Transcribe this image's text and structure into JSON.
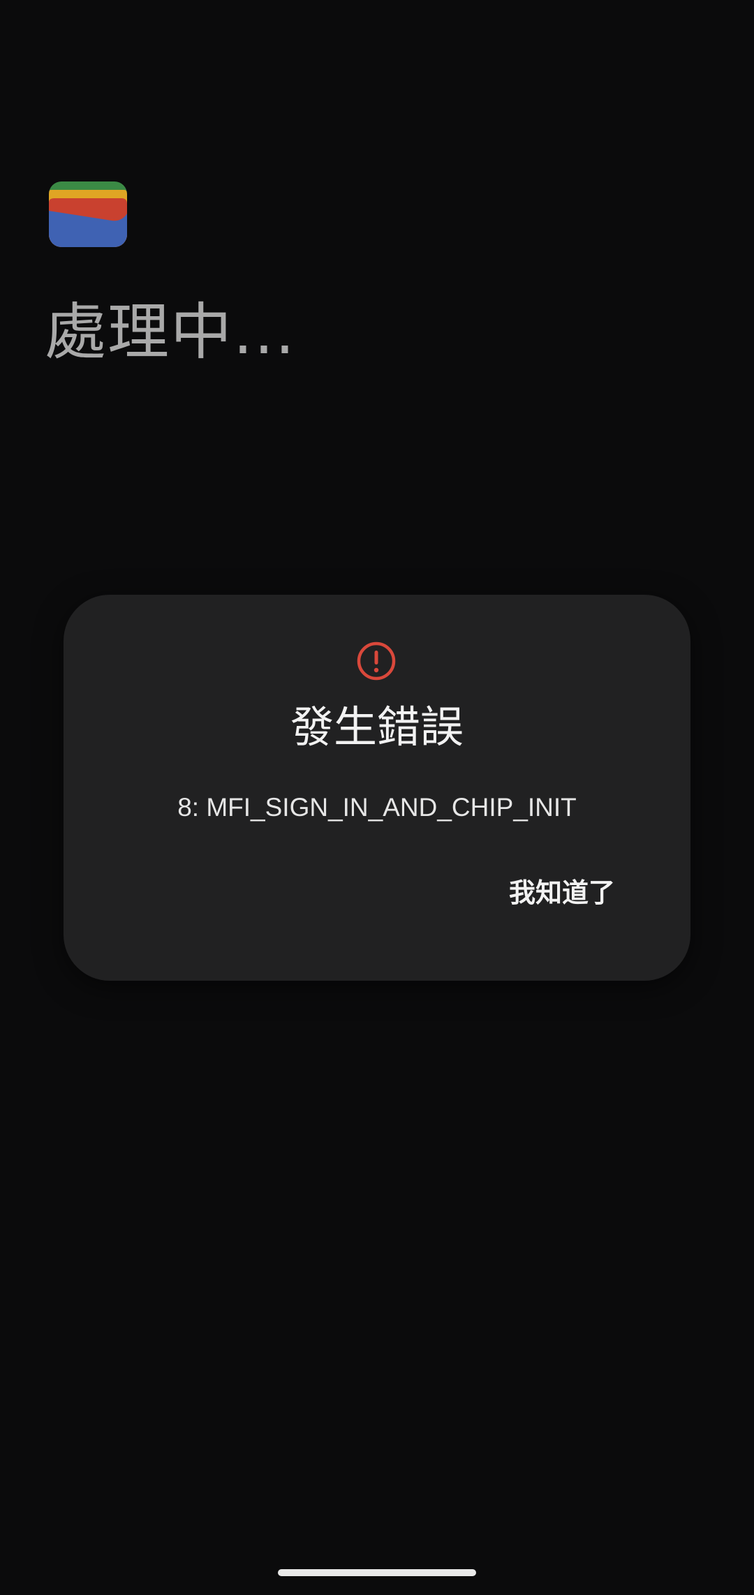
{
  "app": {
    "icon": "google-wallet-icon",
    "status_title": "處理中..."
  },
  "dialog": {
    "icon": "error-alert-icon",
    "title": "發生錯誤",
    "message": "8: MFI_SIGN_IN_AND_CHIP_INIT",
    "confirm_label": "我知道了"
  },
  "colors": {
    "background": "#0b0b0c",
    "dialog_background": "#212122",
    "error_red": "#d9483b",
    "status_text": "#a9a9a9",
    "wallet_green": "#3b8a45",
    "wallet_yellow": "#e0a524",
    "wallet_red": "#c9412f",
    "wallet_blue": "#3f62b3"
  },
  "system": {
    "home_indicator": "home-indicator-bar"
  }
}
